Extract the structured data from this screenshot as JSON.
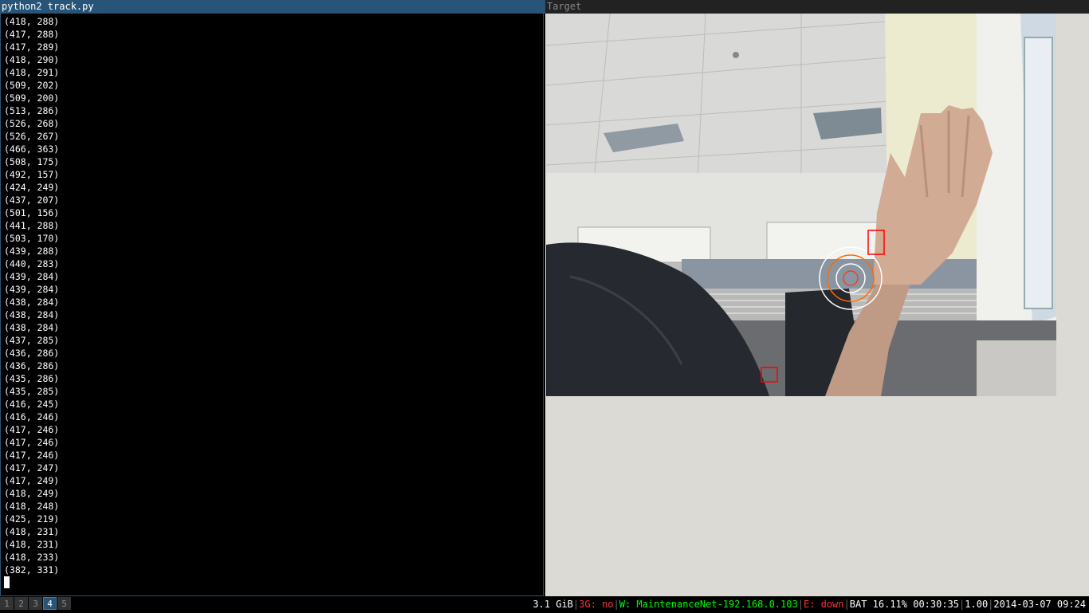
{
  "terminal": {
    "title": "python2 track.py",
    "lines": [
      "(418, 288)",
      "(417, 288)",
      "(417, 289)",
      "(418, 290)",
      "(418, 291)",
      "(509, 202)",
      "(509, 200)",
      "(513, 286)",
      "(526, 268)",
      "(526, 267)",
      "(466, 363)",
      "(508, 175)",
      "(492, 157)",
      "(424, 249)",
      "(437, 207)",
      "(501, 156)",
      "(441, 288)",
      "(503, 170)",
      "(439, 288)",
      "(440, 283)",
      "(439, 284)",
      "(439, 284)",
      "(438, 284)",
      "(438, 284)",
      "(438, 284)",
      "(437, 285)",
      "(436, 286)",
      "(436, 286)",
      "(435, 286)",
      "(435, 285)",
      "(416, 245)",
      "(416, 246)",
      "(417, 246)",
      "(417, 246)",
      "(417, 246)",
      "(417, 247)",
      "(417, 249)",
      "(418, 249)",
      "(418, 248)",
      "(425, 219)",
      "(418, 231)",
      "(418, 231)",
      "(418, 233)",
      "(382, 331)"
    ]
  },
  "target": {
    "title": "Target"
  },
  "workspaces": [
    "1",
    "2",
    "3",
    "4",
    "5"
  ],
  "active_workspace": "4",
  "status": {
    "memory": "3.1 GiB",
    "g3": "3G: no",
    "wifi": "W: MaintenanceNet-192.168.0.103",
    "ethernet": "E: down",
    "battery": "BAT 16.11% 00:30:35",
    "load": "1.00",
    "datetime": "2014-03-07 09:24"
  },
  "colors": {
    "title_active": "#285577",
    "status_red": "#ff3333",
    "status_green": "#00ff00"
  }
}
